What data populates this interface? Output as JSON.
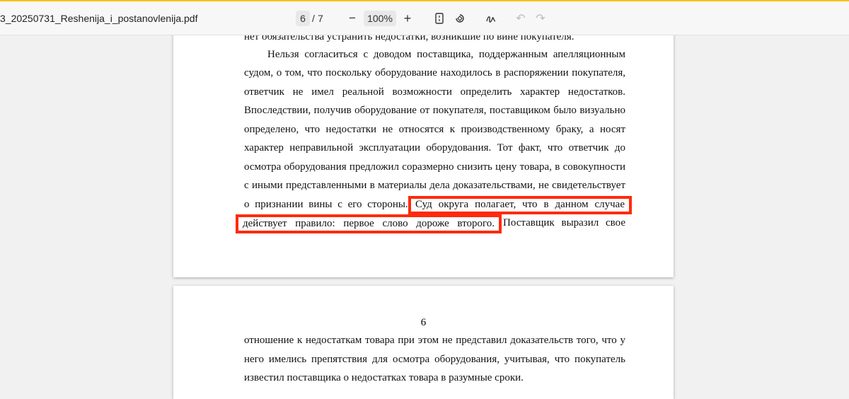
{
  "toolbar": {
    "filename": "3_20250731_Reshenija_i_postanovlenija.pdf",
    "current_page": "6",
    "page_sep": "/",
    "total_pages": "7",
    "zoom_out": "−",
    "zoom": "100%",
    "zoom_in": "+"
  },
  "page1": {
    "lines": [
      "нет обязательства устранить недостатки, возникшие по вине покупателя.",
      "Нельзя согласиться с доводом поставщика, поддержанным апелляционным",
      "судом, о том, что поскольку оборудование находилось в распоряжении покупателя,",
      "ответчик не имел реальной возможности определить характер недостатков.",
      "Впоследствии, получив оборудование от покупателя, поставщиком было визуально",
      "определено, что недостатки не относятся к производственному браку, а носят",
      "характер неправильной эксплуатации оборудования. Тот факт, что ответчик до",
      "осмотра оборудования предложил соразмерно снизить цену товара, в совокупности",
      "с иными представленными в материалы дела доказательствами, не свидетельствует",
      "о признании вины с его стороны.",
      "Поставщик выразил свое"
    ],
    "highlight1": "Суд округа полагает, что в данном случае",
    "highlight2": "действует правило: первое слово дороже второго."
  },
  "page2": {
    "page_number": "6",
    "lines": [
      "отношение к недостаткам товара при этом не представил доказательств того, что у",
      "него имелись препятствия для осмотра оборудования, учитывая, что покупатель",
      "известил поставщика о недостатках товара в разумные сроки."
    ]
  },
  "colors": {
    "highlight": "#ff2a0a",
    "accent_top": "#f5c518"
  }
}
